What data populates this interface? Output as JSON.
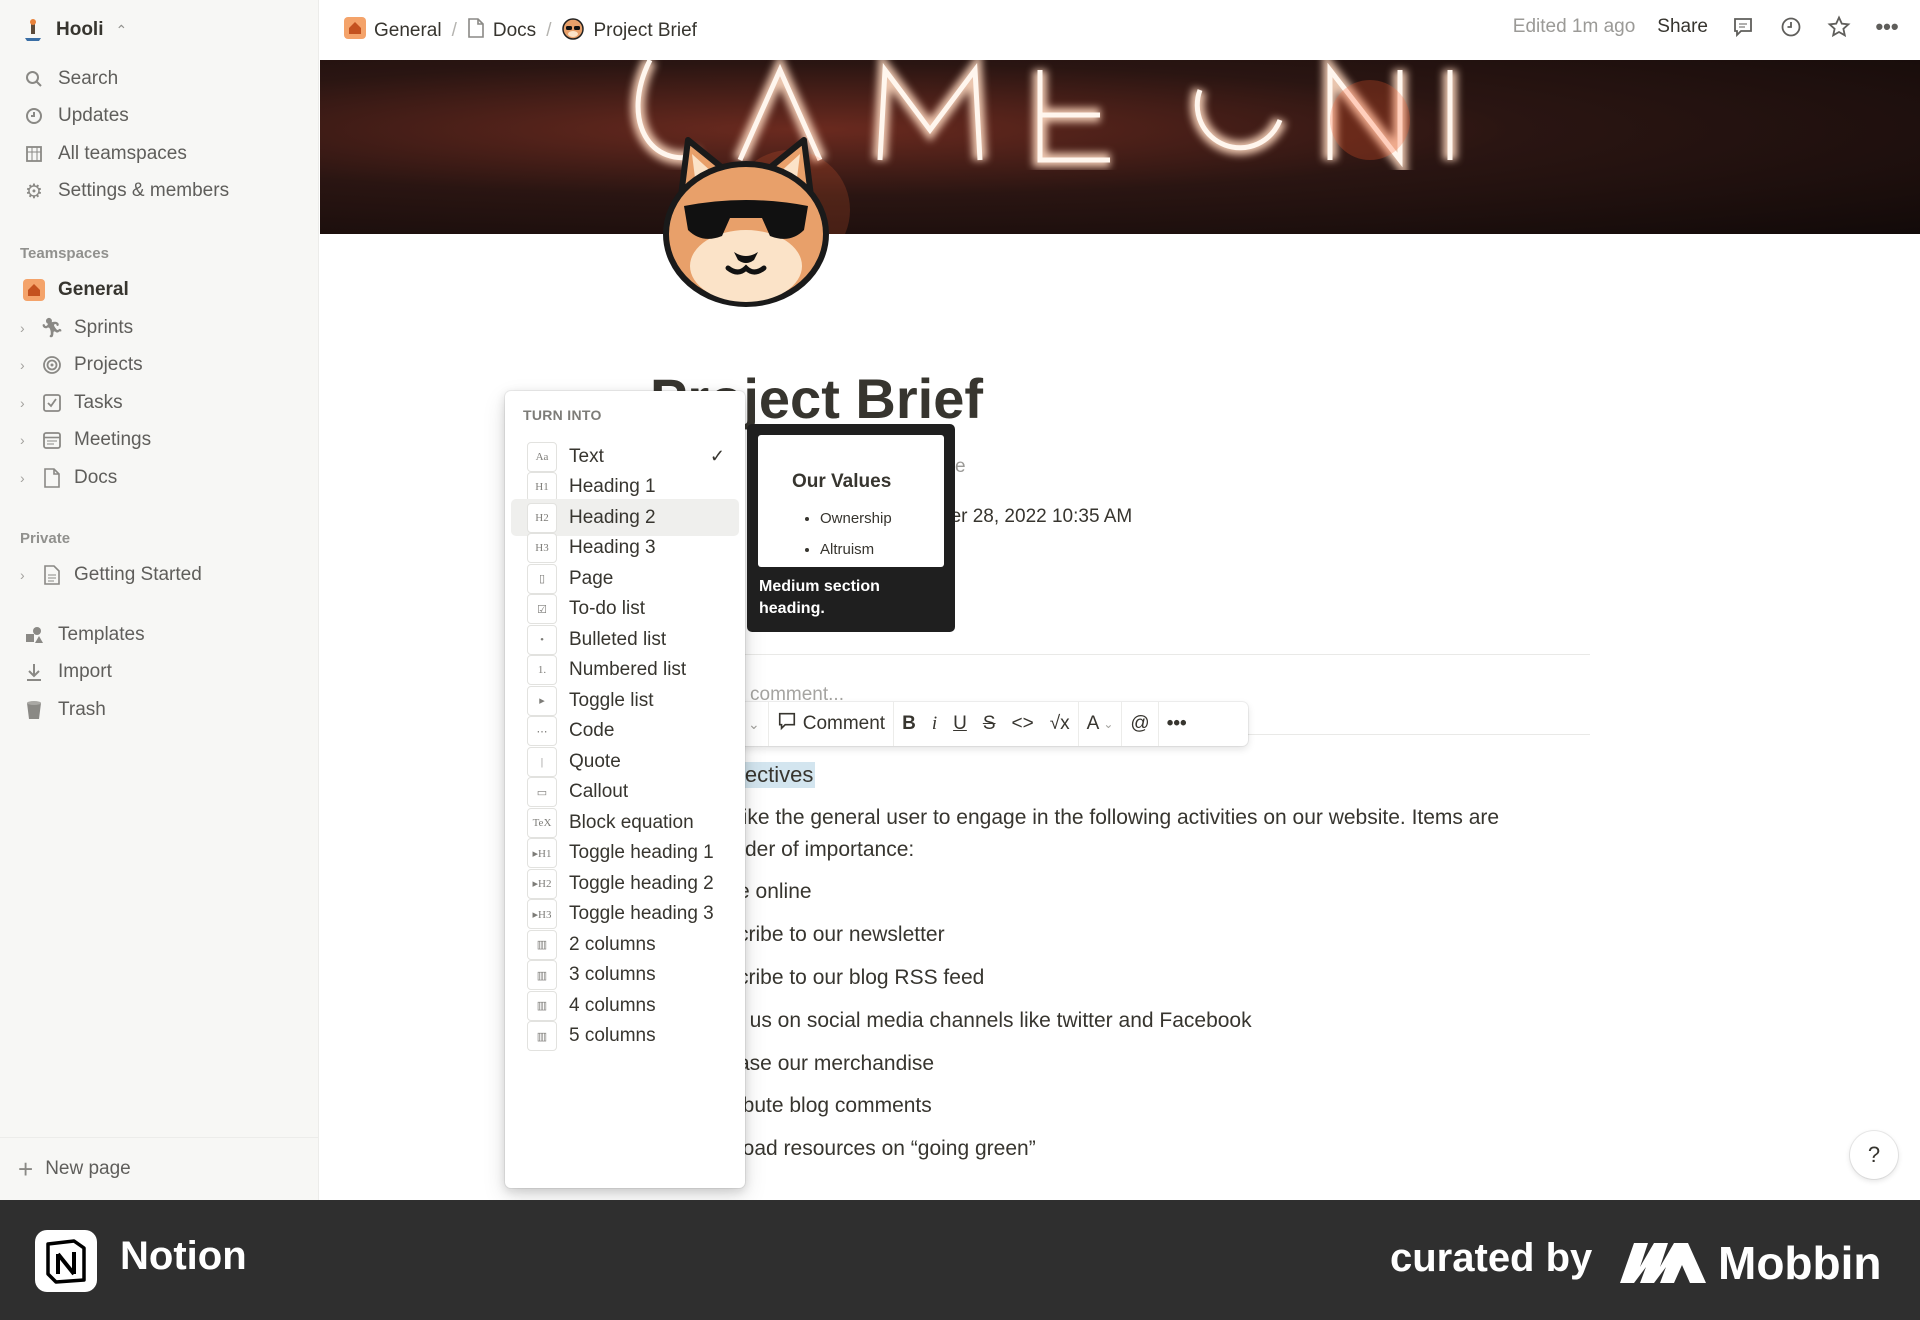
{
  "workspace": {
    "name": "Hooli"
  },
  "sidebar": {
    "nav": [
      {
        "label": "Search",
        "icon": "search-icon"
      },
      {
        "label": "Updates",
        "icon": "clock-icon"
      },
      {
        "label": "All teamspaces",
        "icon": "grid-icon"
      },
      {
        "label": "Settings & members",
        "icon": "gear-icon"
      }
    ],
    "teamspaces_label": "Teamspaces",
    "teamspaces": [
      {
        "label": "General",
        "icon": "house-icon"
      },
      {
        "label": "Sprints",
        "icon": "runner-icon"
      },
      {
        "label": "Projects",
        "icon": "target-icon"
      },
      {
        "label": "Tasks",
        "icon": "checkbox-icon"
      },
      {
        "label": "Meetings",
        "icon": "calendar-icon"
      },
      {
        "label": "Docs",
        "icon": "document-icon"
      }
    ],
    "private_label": "Private",
    "private": [
      {
        "label": "Getting Started",
        "icon": "document-icon"
      }
    ],
    "bottom": [
      {
        "label": "Templates",
        "icon": "shapes-icon"
      },
      {
        "label": "Import",
        "icon": "download-icon"
      },
      {
        "label": "Trash",
        "icon": "trash-icon"
      }
    ],
    "new_page": "New page"
  },
  "topbar": {
    "breadcrumbs": [
      "General",
      "Docs",
      "Project Brief"
    ],
    "edited": "Edited 1m ago",
    "share": "Share"
  },
  "page": {
    "title": "Project Brief",
    "prop_fragment": "e",
    "date_fragment": "ber 28, 2022 10:35 AM",
    "comment_placeholder": "comment...",
    "selected_heading": "jectives",
    "body_lines": [
      "like the general user to engage in the following activities on our website. Items are",
      "rder of importance:",
      "e online",
      "cribe to our newsletter",
      "cribe to our blog RSS feed",
      "/ us on social media channels like twitter and Facebook",
      "ase our merchandise",
      "ibute blog comments",
      "load resources on “going green”"
    ]
  },
  "format_toolbar": {
    "comment": "Comment"
  },
  "turn_into_menu": {
    "title": "TURN INTO",
    "items": [
      {
        "label": "Text",
        "thumb": "Aa",
        "checked": true
      },
      {
        "label": "Heading 1",
        "thumb": "H1"
      },
      {
        "label": "Heading 2",
        "thumb": "H2",
        "hover": true
      },
      {
        "label": "Heading 3",
        "thumb": "H3"
      },
      {
        "label": "Page",
        "thumb": "▯"
      },
      {
        "label": "To-do list",
        "thumb": "☑"
      },
      {
        "label": "Bulleted list",
        "thumb": "•"
      },
      {
        "label": "Numbered list",
        "thumb": "1."
      },
      {
        "label": "Toggle list",
        "thumb": "▸"
      },
      {
        "label": "Code",
        "thumb": "⋯"
      },
      {
        "label": "Quote",
        "thumb": "|"
      },
      {
        "label": "Callout",
        "thumb": "▭"
      },
      {
        "label": "Block equation",
        "thumb": "TeX"
      },
      {
        "label": "Toggle heading 1",
        "thumb": "▸H1"
      },
      {
        "label": "Toggle heading 2",
        "thumb": "▸H2"
      },
      {
        "label": "Toggle heading 3",
        "thumb": "▸H3"
      },
      {
        "label": "2 columns",
        "thumb": "▥"
      },
      {
        "label": "3 columns",
        "thumb": "▥"
      },
      {
        "label": "4 columns",
        "thumb": "▥"
      },
      {
        "label": "5 columns",
        "thumb": "▥"
      }
    ]
  },
  "tooltip": {
    "heading": "Our Values",
    "bullets": [
      "Ownership",
      "Altruism"
    ],
    "caption": "Medium section heading."
  },
  "help": "?",
  "footer": {
    "app": "Notion",
    "curated": "curated by",
    "brand": "Mobbin"
  },
  "colors": {
    "sidebar_bg": "#f7f7f5",
    "selection": "#d3e5ef",
    "footer_bg": "#2f2f2f",
    "accent_orange": "#e8823a"
  }
}
